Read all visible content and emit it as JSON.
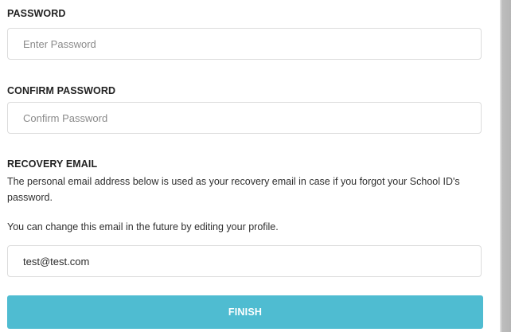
{
  "password": {
    "label": "PASSWORD",
    "placeholder": "Enter Password",
    "value": ""
  },
  "confirm_password": {
    "label": "CONFIRM PASSWORD",
    "placeholder": "Confirm Password",
    "value": ""
  },
  "recovery_email": {
    "label": "RECOVERY EMAIL",
    "description": "The personal email address below is used as your recovery email in case if you forgot your School ID's password.",
    "note": "You can change this email in the future by editing your profile.",
    "value": "test@test.com"
  },
  "actions": {
    "finish_label": "FINISH"
  },
  "colors": {
    "button": "#4fbcd1",
    "border": "#dcdcdc"
  }
}
